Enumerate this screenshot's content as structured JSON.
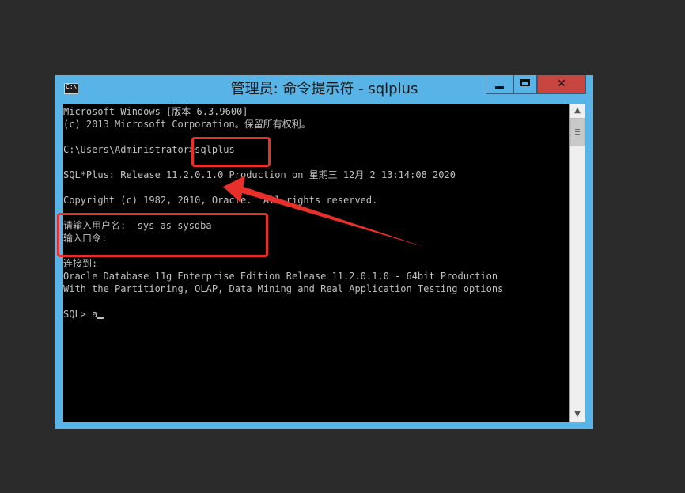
{
  "window": {
    "title": "管理员: 命令提示符 - sqlplus",
    "icon": "console-icon",
    "controls": {
      "minimize": "minimize-icon",
      "maximize": "maximize-icon",
      "close": "✕"
    }
  },
  "console": {
    "lines": [
      "Microsoft Windows [版本 6.3.9600]",
      "(c) 2013 Microsoft Corporation。保留所有权利。",
      "",
      "C:\\Users\\Administrator>sqlplus",
      "",
      "SQL*Plus: Release 11.2.0.1.0 Production on 星期三 12月 2 13:14:08 2020",
      "",
      "Copyright (c) 1982, 2010, Oracle.  All rights reserved.",
      "",
      "请输入用户名:  sys as sysdba",
      "输入口令:",
      "",
      "连接到:",
      "Oracle Database 11g Enterprise Edition Release 11.2.0.1.0 - 64bit Production",
      "With the Partitioning, OLAP, Data Mining and Real Application Testing options",
      "",
      "SQL> a"
    ]
  },
  "scrollbar": {
    "up_arrow": "▲",
    "down_arrow": "▼",
    "position": 0.0
  },
  "annotations": {
    "color": "#e8302a",
    "highlights": [
      "sqlplus",
      "请输入用户名:  sys as sysdba / 输入口令:"
    ],
    "arrow": "arrow-icon"
  }
}
